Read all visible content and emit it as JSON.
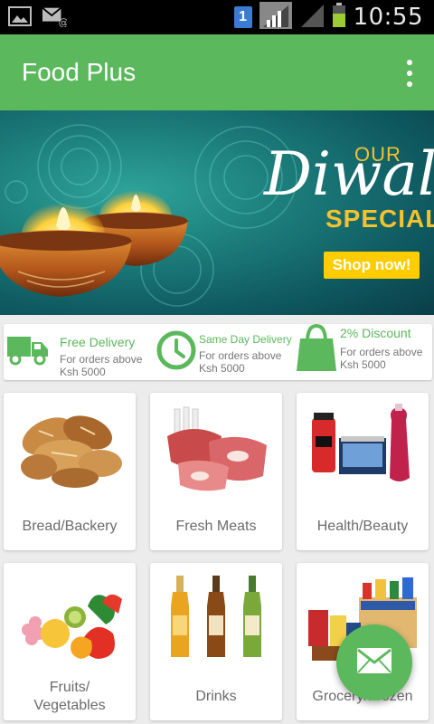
{
  "status_bar": {
    "left_icons": [
      "image-icon",
      "mail-at-icon"
    ],
    "sim": "1",
    "time": "10:55"
  },
  "app": {
    "title": "Food Plus",
    "menu_icon": "more-vertical-icon",
    "primary_color": "#5cb85c"
  },
  "banner": {
    "our": "OUR",
    "diwali": "Diwali",
    "specials": "SPECIALS",
    "cta": "Shop now!",
    "accent": "#f2c230",
    "button_color": "#ffcc00"
  },
  "features": [
    {
      "icon": "delivery-truck-icon",
      "title": "Free Delivery",
      "line1": "For orders above",
      "line2": "Ksh 5000"
    },
    {
      "icon": "clock-icon",
      "title": "Same Day Delivery",
      "line1": "For orders above",
      "line2": "Ksh 5000"
    },
    {
      "icon": "shopping-bag-icon",
      "title": "2% Discount",
      "line1": "For orders above",
      "line2": "Ksh 5000"
    }
  ],
  "categories": [
    {
      "label": "Bread/Backery",
      "image": "bread-image"
    },
    {
      "label": "Fresh Meats",
      "image": "meat-image"
    },
    {
      "label": "Health/Beauty",
      "image": "toiletries-image"
    },
    {
      "label": "Fruits/\nVegetables",
      "image": "fruits-image"
    },
    {
      "label": "Drinks",
      "image": "drinks-image"
    },
    {
      "label": "Grocery/Frozen",
      "image": "grocery-image"
    }
  ],
  "fab": {
    "icon": "mail-icon"
  }
}
